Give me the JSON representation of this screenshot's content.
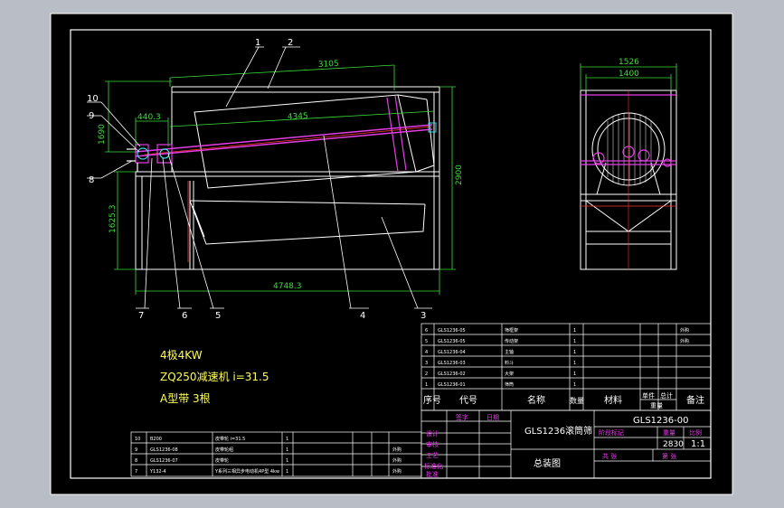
{
  "colors": {
    "canvas_bg": "#b9bec6",
    "sheet": "#000000",
    "line": "#ffffff",
    "dim": "#3cdc3c",
    "part": "#e53de5",
    "accent_red": "#ff3030",
    "note_text": "#ffff55",
    "cyan": "#38d8e8"
  },
  "drawing": {
    "callouts": [
      "1",
      "2",
      "3",
      "4",
      "5",
      "6",
      "7",
      "8",
      "9",
      "10"
    ],
    "dimensions": {
      "top_length": "3105",
      "drum_length": "4345",
      "left_offset": "440.3",
      "left_height": "1690",
      "lower_height": "1625.3",
      "overall_length": "4748.3",
      "overall_height": "2900",
      "side_outer_width": "1526",
      "side_inner_width": "1400"
    }
  },
  "notes": [
    "4极4KW",
    "ZQ250减速机 i=31.5",
    "A型带 3根"
  ],
  "bom_main": {
    "rows": [
      {
        "no": "6",
        "code": "GLS1236-05",
        "name": "筛框架",
        "qty": "1",
        "remark": "外购"
      },
      {
        "no": "5",
        "code": "GLS1236-05",
        "name": "传动架",
        "qty": "1",
        "remark": "外购"
      },
      {
        "no": "4",
        "code": "GLS1236-04",
        "name": "主轴",
        "qty": "1",
        "remark": ""
      },
      {
        "no": "3",
        "code": "GLS1236-03",
        "name": "料斗",
        "qty": "1",
        "remark": ""
      },
      {
        "no": "2",
        "code": "GLS1236-02",
        "name": "大架",
        "qty": "1",
        "remark": ""
      },
      {
        "no": "1",
        "code": "GLS1236-01",
        "name": "筛筒",
        "qty": "1",
        "remark": ""
      }
    ],
    "header": {
      "no": "序号",
      "code": "代号",
      "name": "名称",
      "qty": "数量",
      "material": "材料",
      "unit_weight": "单件",
      "total_weight": "总计",
      "weight_label": "重量",
      "remark": "备注"
    }
  },
  "bom_second": {
    "rows": [
      {
        "no": "10",
        "code": "B200",
        "name": "皮带轮 i=31.5",
        "qty": "1",
        "remark": ""
      },
      {
        "no": "9",
        "code": "GLS1236-08",
        "name": "皮带轮组",
        "qty": "1",
        "remark": "外购"
      },
      {
        "no": "8",
        "code": "GLS1236-07",
        "name": "皮带轮",
        "qty": "1",
        "remark": "外购"
      },
      {
        "no": "7",
        "code": "Y132-4",
        "name": "Y系列三相异步电动机4P型 4kw",
        "qty": "1",
        "remark": "外购"
      }
    ]
  },
  "title_block": {
    "drawing_name": "GLS1236滚筒筛",
    "assembly": "总装图",
    "drawing_no": "GLS1236-00",
    "weight": "2830",
    "scale": "1:1",
    "label_design": "设计",
    "label_check": "审核",
    "label_process": "工艺",
    "label_standard": "标准化",
    "label_approve": "批准",
    "label_stage": "阶段标记",
    "label_weight": "重量",
    "label_scale": "比例",
    "label_sheet": "共 张",
    "label_page": "第 张",
    "sign_a": "签字",
    "sign_b": "日期"
  }
}
